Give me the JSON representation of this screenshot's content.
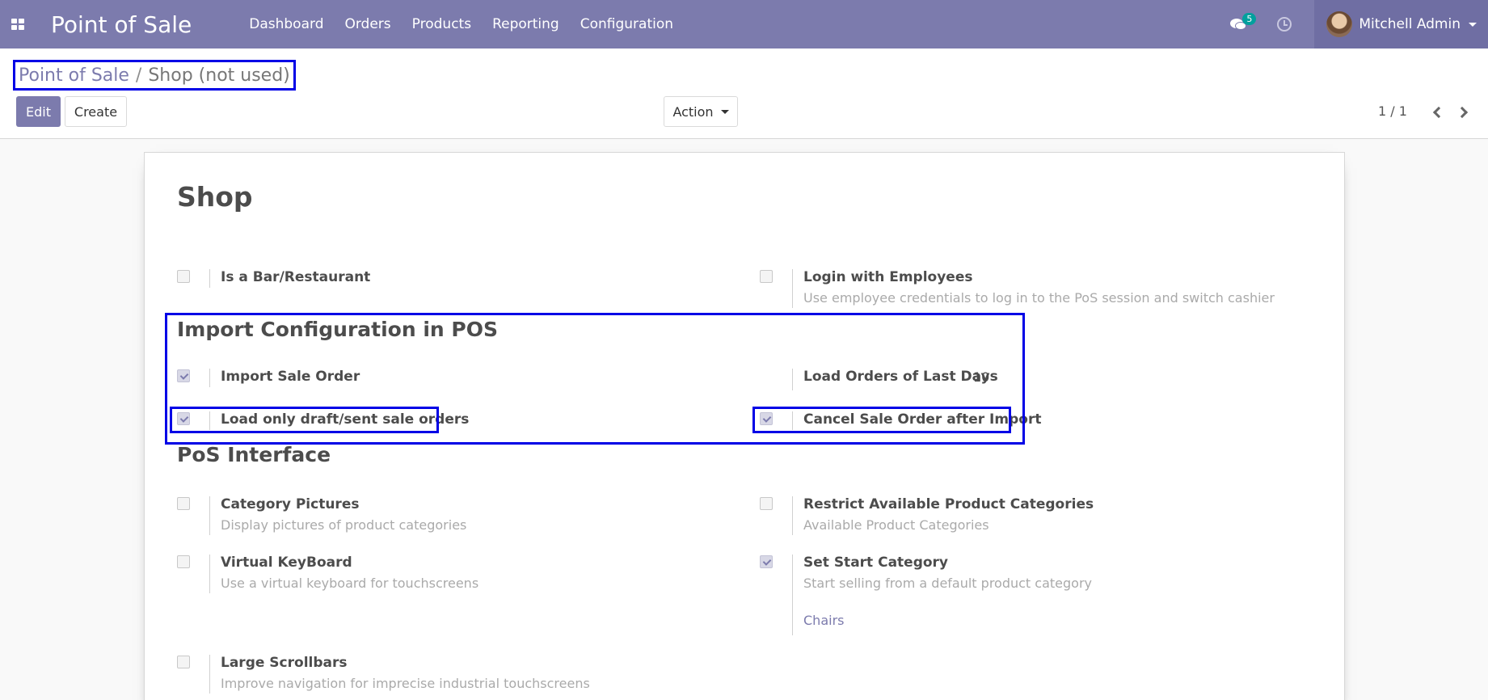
{
  "navbar": {
    "apps_icon": "apps-grid-icon",
    "brand": "Point of Sale",
    "menu": [
      "Dashboard",
      "Orders",
      "Products",
      "Reporting",
      "Configuration"
    ],
    "messages_count": "5",
    "user_name": "Mitchell Admin"
  },
  "breadcrumb": {
    "parent": "Point of Sale",
    "separator": "/",
    "current": "Shop (not used)"
  },
  "toolbar": {
    "edit_label": "Edit",
    "create_label": "Create",
    "action_label": "Action",
    "pager": "1 / 1"
  },
  "form": {
    "title": "Shop",
    "general": {
      "is_bar": {
        "label": "Is a Bar/Restaurant",
        "checked": false
      },
      "login_employees": {
        "label": "Login with Employees",
        "desc": "Use employee credentials to log in to the PoS session and switch cashier",
        "checked": false
      }
    },
    "import_section": {
      "title": "Import Configuration in POS",
      "import_sale_order": {
        "label": "Import Sale Order",
        "checked": true
      },
      "load_last_days": {
        "label": "Load Orders of Last Days",
        "value": "10"
      },
      "load_draft": {
        "label": "Load only draft/sent sale orders",
        "checked": true
      },
      "cancel_after_import": {
        "label": "Cancel Sale Order after Import",
        "checked": true
      }
    },
    "interface_section": {
      "title": "PoS Interface",
      "category_pictures": {
        "label": "Category Pictures",
        "desc": "Display pictures of product categories",
        "checked": false
      },
      "restrict_categories": {
        "label": "Restrict Available Product Categories",
        "desc": "Available Product Categories",
        "checked": false
      },
      "virtual_keyboard": {
        "label": "Virtual KeyBoard",
        "desc": "Use a virtual keyboard for touchscreens",
        "checked": false
      },
      "start_category": {
        "label": "Set Start Category",
        "desc": "Start selling from a default product category",
        "value": "Chairs",
        "checked": true
      },
      "large_scrollbars": {
        "label": "Large Scrollbars",
        "desc": "Improve navigation for imprecise industrial touchscreens",
        "checked": false
      }
    }
  },
  "colors": {
    "primary": "#7c7bad",
    "highlight": "#0000e6"
  }
}
